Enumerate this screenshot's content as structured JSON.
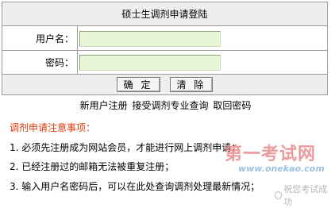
{
  "form": {
    "title": "硕士生调剂申请登陆",
    "username_label": "用户名：",
    "username_value": "",
    "password_label": "密码：",
    "password_value": "",
    "confirm_button": "确 定",
    "clear_button": "清 除"
  },
  "links": {
    "register": "新用户注册",
    "query": "接受调剂专业查询",
    "retrieve_password": "取回密码"
  },
  "notice": {
    "title": "调剂申请注意事项：",
    "items": [
      "1.  必须先注册成为网站会员，才能进行网上调剂申请；",
      "2.  已经注册过的邮箱无法被重复注册；",
      "3.  输入用户名密码后，可以在此处查询调剂处理最新情况；"
    ]
  },
  "watermark": {
    "logo_text": "第一考试网",
    "url": "www.onekao.com",
    "slogan": "祝您考试成功"
  },
  "colors": {
    "notice_title": "#e03a0c",
    "input_background": "#e8f5d8",
    "header_background": "#eeeeee"
  }
}
